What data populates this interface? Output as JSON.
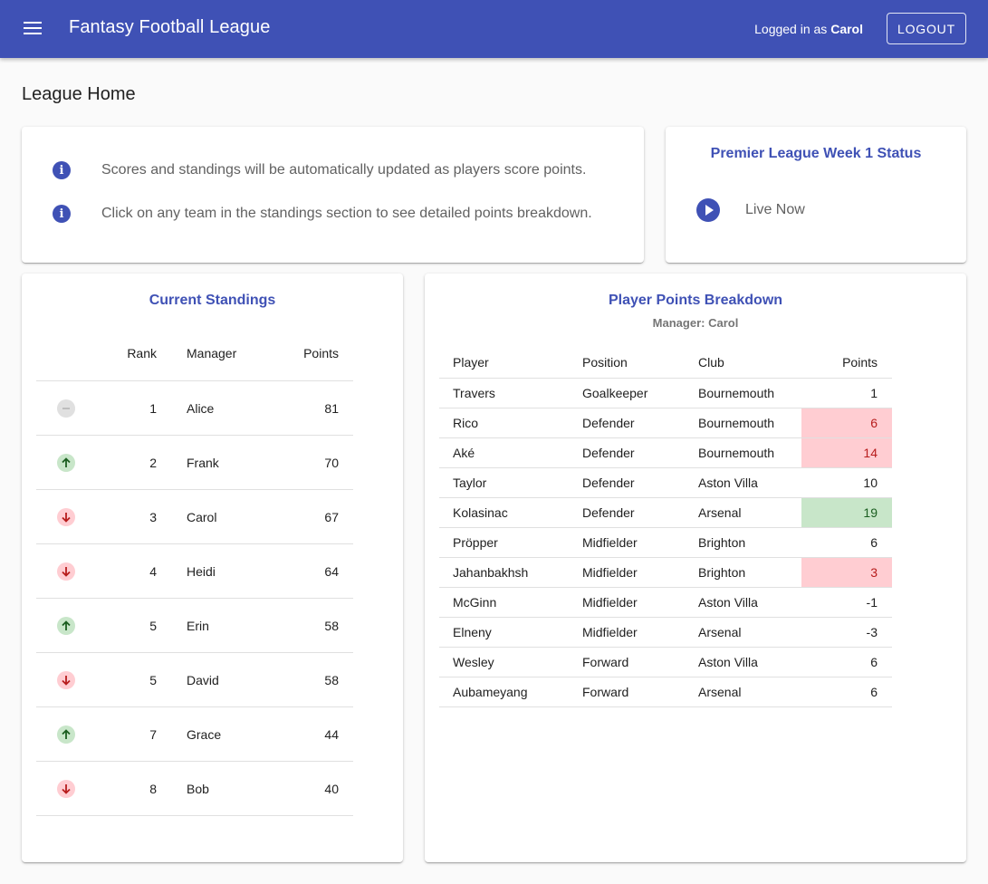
{
  "appbar": {
    "title": "Fantasy Football League",
    "logged_in_prefix": "Logged in as",
    "user": "Carol",
    "logout_label": "LOGOUT",
    "color": "#3f51b5"
  },
  "page": {
    "title": "League Home"
  },
  "info": {
    "lines": [
      "Scores and standings will be automatically updated as players score points.",
      "Click on any team in the standings section to see detailed points breakdown."
    ]
  },
  "status": {
    "title": "Premier League Week 1 Status",
    "live_label": "Live Now"
  },
  "standings": {
    "title": "Current Standings",
    "headers": {
      "rank": "Rank",
      "manager": "Manager",
      "points": "Points"
    },
    "rows": [
      {
        "movement": "same",
        "rank": "1",
        "manager": "Alice",
        "points": "81"
      },
      {
        "movement": "up",
        "rank": "2",
        "manager": "Frank",
        "points": "70"
      },
      {
        "movement": "down",
        "rank": "3",
        "manager": "Carol",
        "points": "67"
      },
      {
        "movement": "down",
        "rank": "4",
        "manager": "Heidi",
        "points": "64"
      },
      {
        "movement": "up",
        "rank": "5",
        "manager": "Erin",
        "points": "58"
      },
      {
        "movement": "down",
        "rank": "5",
        "manager": "David",
        "points": "58"
      },
      {
        "movement": "up",
        "rank": "7",
        "manager": "Grace",
        "points": "44"
      },
      {
        "movement": "down",
        "rank": "8",
        "manager": "Bob",
        "points": "40"
      }
    ]
  },
  "breakdown": {
    "title": "Player Points Breakdown",
    "subtitle": "Manager: Carol",
    "headers": {
      "player": "Player",
      "position": "Position",
      "club": "Club",
      "points": "Points"
    },
    "rows": [
      {
        "player": "Travers",
        "position": "Goalkeeper",
        "club": "Bournemouth",
        "points": "1",
        "highlight": "none"
      },
      {
        "player": "Rico",
        "position": "Defender",
        "club": "Bournemouth",
        "points": "6",
        "highlight": "negative"
      },
      {
        "player": "Aké",
        "position": "Defender",
        "club": "Bournemouth",
        "points": "14",
        "highlight": "negative"
      },
      {
        "player": "Taylor",
        "position": "Defender",
        "club": "Aston Villa",
        "points": "10",
        "highlight": "none"
      },
      {
        "player": "Kolasinac",
        "position": "Defender",
        "club": "Arsenal",
        "points": "19",
        "highlight": "positive"
      },
      {
        "player": "Pröpper",
        "position": "Midfielder",
        "club": "Brighton",
        "points": "6",
        "highlight": "none"
      },
      {
        "player": "Jahanbakhsh",
        "position": "Midfielder",
        "club": "Brighton",
        "points": "3",
        "highlight": "negative"
      },
      {
        "player": "McGinn",
        "position": "Midfielder",
        "club": "Aston Villa",
        "points": "-1",
        "highlight": "none"
      },
      {
        "player": "Elneny",
        "position": "Midfielder",
        "club": "Arsenal",
        "points": "-3",
        "highlight": "none"
      },
      {
        "player": "Wesley",
        "position": "Forward",
        "club": "Aston Villa",
        "points": "6",
        "highlight": "none"
      },
      {
        "player": "Aubameyang",
        "position": "Forward",
        "club": "Arsenal",
        "points": "6",
        "highlight": "none"
      }
    ]
  }
}
